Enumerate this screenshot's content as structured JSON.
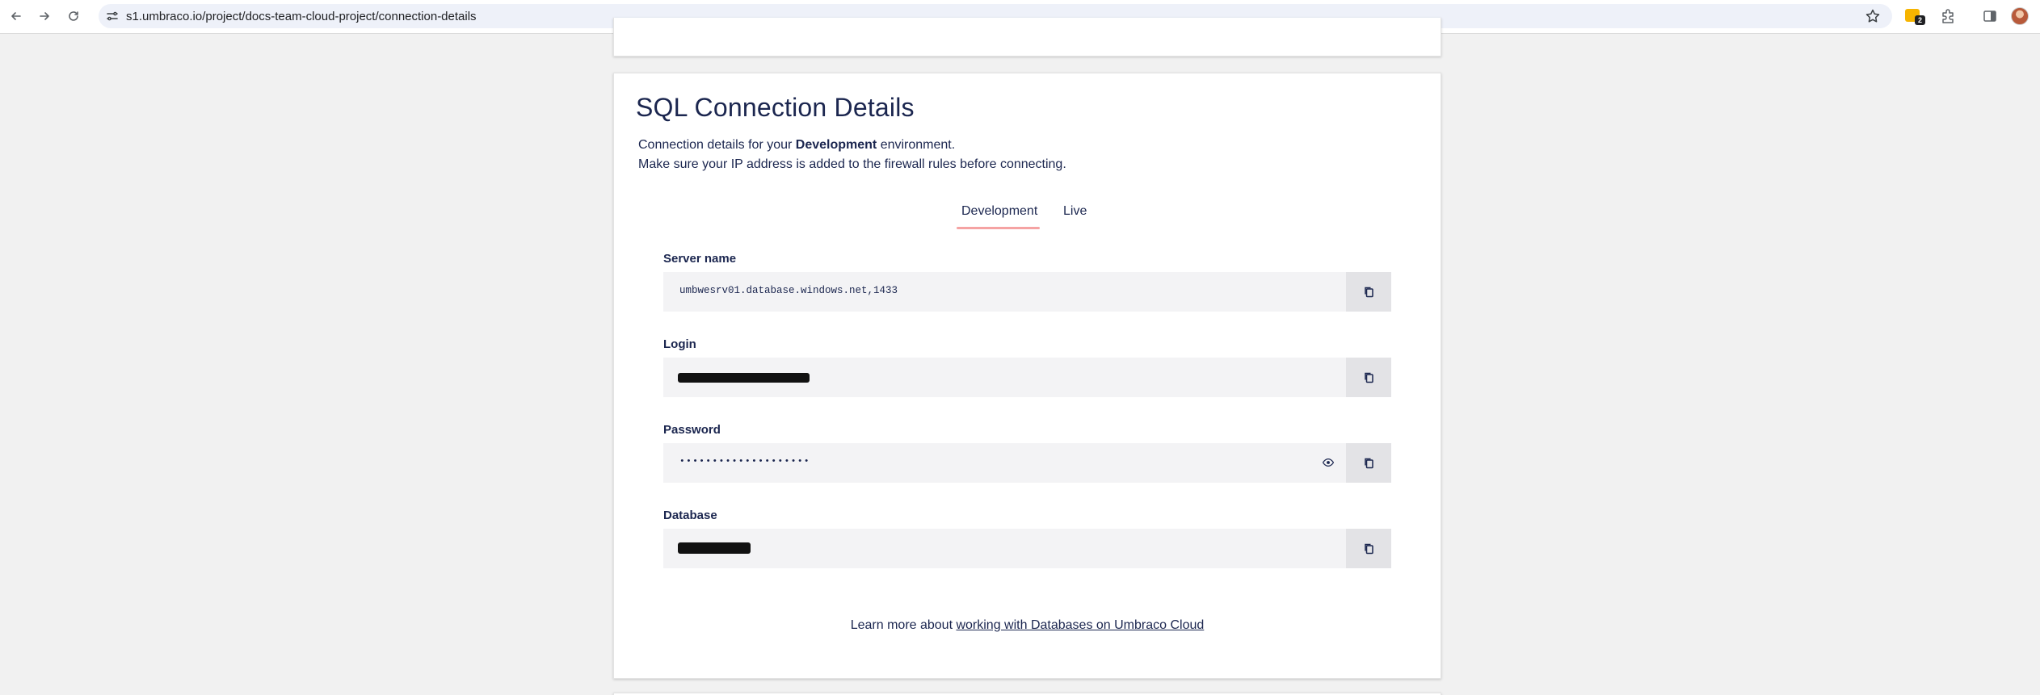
{
  "browser": {
    "url": "s1.umbraco.io/project/docs-team-cloud-project/connection-details",
    "extension_badge": "2"
  },
  "card": {
    "title": "SQL Connection Details",
    "desc_line1_prefix": "Connection details for your ",
    "desc_line1_bold": "Development",
    "desc_line1_suffix": " environment.",
    "desc_line2": "Make sure your IP address is added to the firewall rules before connecting.",
    "tabs": [
      {
        "label": "Development",
        "active": true
      },
      {
        "label": "Live",
        "active": false
      }
    ],
    "fields": {
      "server": {
        "label": "Server name",
        "value": "umbwesrv01.database.windows.net,1433"
      },
      "login": {
        "label": "Login",
        "value": ""
      },
      "password": {
        "label": "Password",
        "value": "••••••••••••••••••••"
      },
      "database": {
        "label": "Database",
        "value": ""
      }
    },
    "learn_prefix": "Learn more about ",
    "learn_link": "working with Databases on Umbraco Cloud"
  },
  "icons": {
    "back": "arrow-left-icon",
    "forward": "arrow-right-icon",
    "reload": "reload-icon",
    "site_info": "tune-icon",
    "bookmark": "star-icon",
    "copy": "copy-icon",
    "show_password": "eye-icon"
  },
  "colors": {
    "page_bg": "#f1f1f1",
    "text": "#1b264f",
    "tab_underline": "#f5a3a3",
    "field_bg": "#f3f3f5",
    "copy_bg": "#e3e3e6"
  }
}
